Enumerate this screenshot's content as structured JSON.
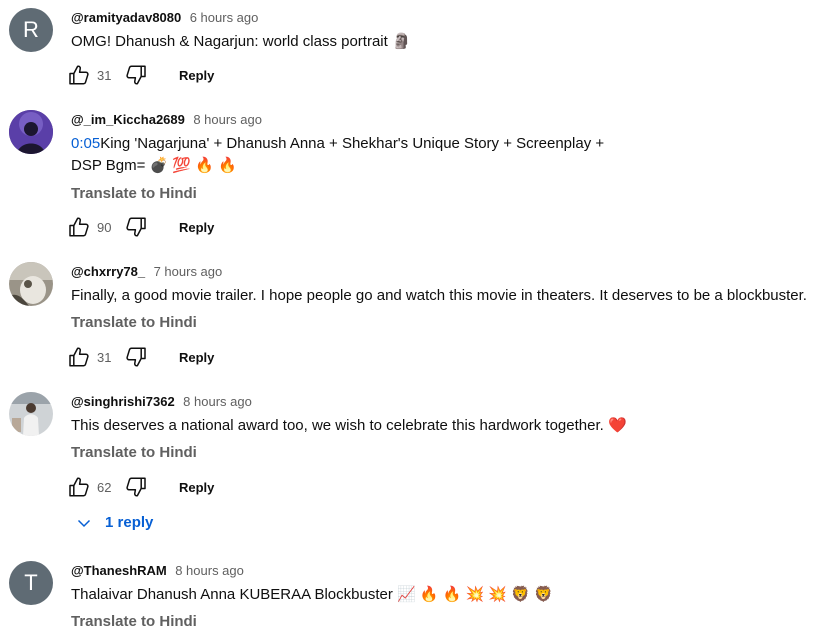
{
  "comments": [
    {
      "avatar_letter": "R",
      "author": "@ramityadav8080",
      "time": "6 hours ago",
      "text": "OMG! Dhanush & Nagarjun: world class portrait",
      "emoji": "🗿",
      "likes": "31",
      "reply_label": "Reply"
    },
    {
      "author": "@_im_Kiccha2689",
      "time": "8 hours ago",
      "timestamp_link": "0:05",
      "text_line1": "King 'Nagarjuna' + Dhanush Anna + Shekhar's Unique Story + Screenplay +",
      "text_line2": "DSP Bgm=",
      "emoji_line2": "💣 💯 🔥 🔥",
      "translate_label": "Translate to Hindi",
      "likes": "90",
      "reply_label": "Reply"
    },
    {
      "author": "@chxrry78_",
      "time": "7 hours ago",
      "text": "Finally, a good movie trailer. I hope people go and watch this movie in theaters. It deserves to be a blockbuster.",
      "translate_label": "Translate to Hindi",
      "likes": "31",
      "reply_label": "Reply"
    },
    {
      "author": "@singhrishi7362",
      "time": "8 hours ago",
      "text": "This deserves a national award too, we wish to celebrate this hardwork together.",
      "emoji": "❤️",
      "translate_label": "Translate to Hindi",
      "likes": "62",
      "reply_label": "Reply",
      "replies_label": "1 reply"
    },
    {
      "avatar_letter": "T",
      "author": "@ThaneshRAM",
      "time": "8 hours ago",
      "text": "Thalaivar Dhanush Anna KUBERAA Blockbuster",
      "emoji": "📈 🔥 🔥 💥 💥 🦁 🦁",
      "translate_label": "Translate to Hindi"
    }
  ],
  "colors": {
    "link_blue": "#065fd4",
    "secondary_text": "#606060",
    "avatar_grey": "#5f6b74"
  },
  "icons": {
    "like": "thumbs-up-icon",
    "dislike": "thumbs-down-icon",
    "expand": "chevron-down-icon"
  }
}
